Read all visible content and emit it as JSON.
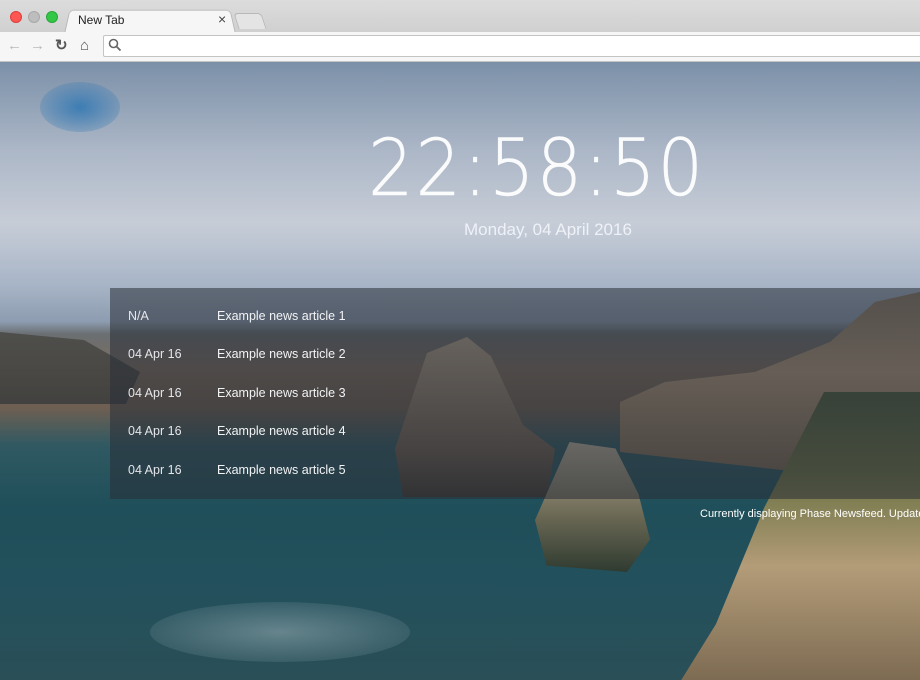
{
  "browser": {
    "tab_title": "New Tab",
    "tab_close": "×",
    "omnibox_value": ""
  },
  "page": {
    "clock": "22:58:50",
    "date": "Monday, 04 April 2016",
    "news": [
      {
        "date": "N/A",
        "title": "Example news article 1"
      },
      {
        "date": "04 Apr 16",
        "title": "Example news article 2"
      },
      {
        "date": "04 Apr 16",
        "title": "Example news article 3"
      },
      {
        "date": "04 Apr 16",
        "title": "Example news article 4"
      },
      {
        "date": "04 Apr 16",
        "title": "Example news article 5"
      }
    ],
    "status": "Currently displaying Phase Newsfeed. Updated eve"
  },
  "icons": {
    "back": "back-arrow-icon",
    "forward": "forward-arrow-icon",
    "reload": "reload-icon",
    "home": "home-icon",
    "search": "search-icon"
  }
}
